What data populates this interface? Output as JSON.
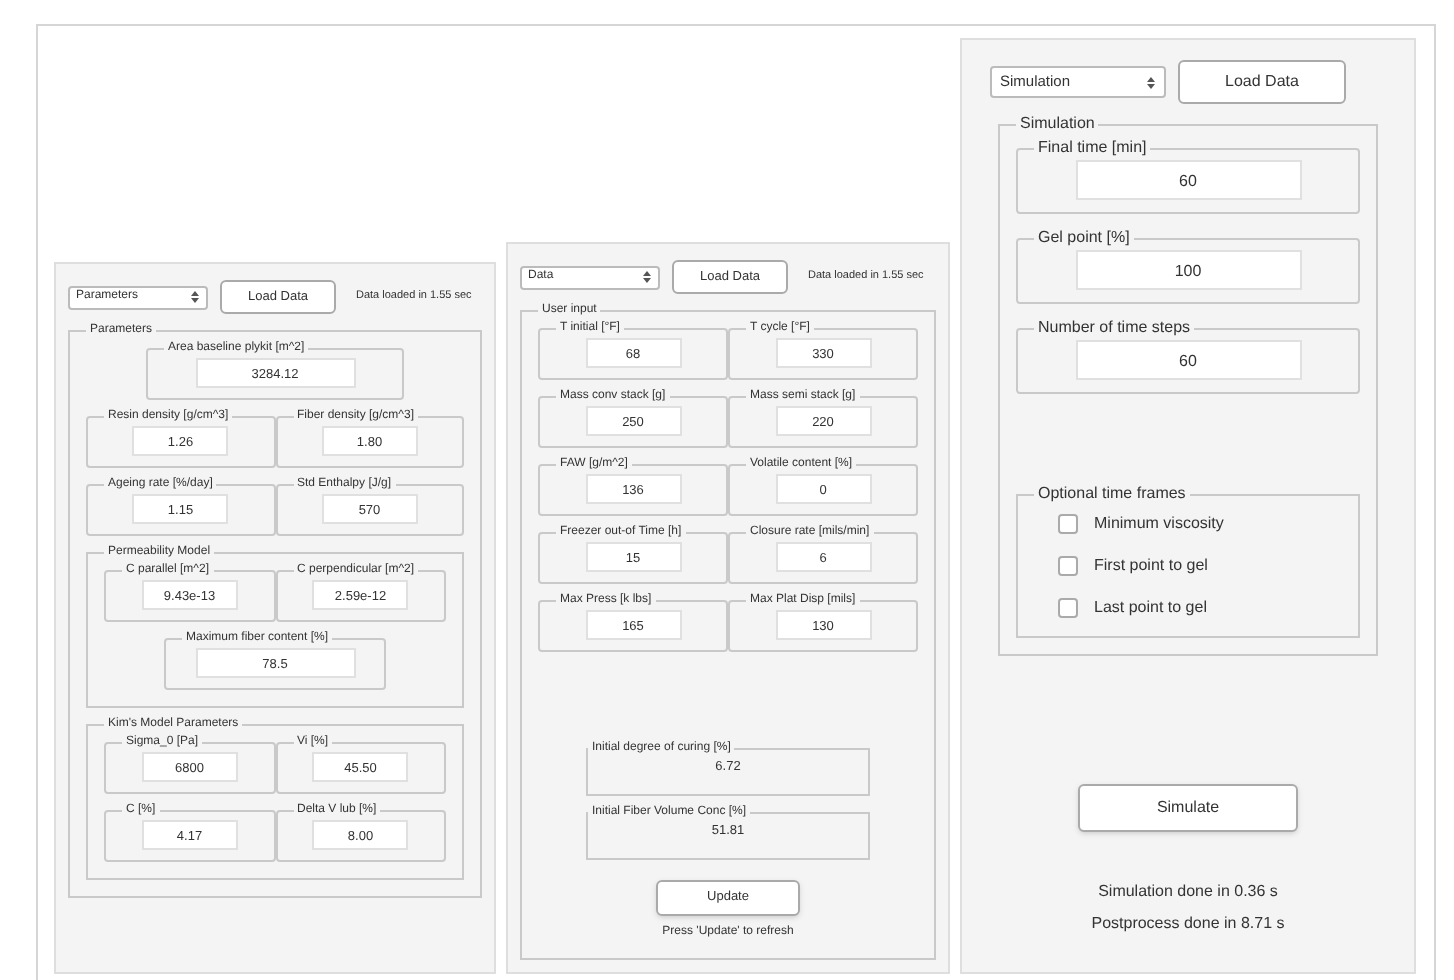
{
  "panels": [
    {
      "dropdown": "Parameters",
      "load_button": "Load Data",
      "status": "Data loaded in 1.55 sec",
      "items": [
        {
          "kind": "group",
          "title": "Parameters",
          "children": [
            {
              "kind": "field",
              "label": "Area baseline plykit [m^2]",
              "value": "3284.12"
            },
            {
              "kind": "pair",
              "fields": [
                {
                  "label": "Resin density [g/cm^3]",
                  "value": "1.26"
                },
                {
                  "label": "Fiber density [g/cm^3]",
                  "value": "1.80"
                }
              ]
            },
            {
              "kind": "pair",
              "fields": [
                {
                  "label": "Ageing rate [%/day]",
                  "value": "1.15"
                },
                {
                  "label": "Std Enthalpy [J/g]",
                  "value": "570"
                }
              ]
            },
            {
              "kind": "group",
              "title": "Permeability Model",
              "children": [
                {
                  "kind": "pair",
                  "fields": [
                    {
                      "label": "C parallel [m^2]",
                      "value": "9.43e-13"
                    },
                    {
                      "label": "C perpendicular [m^2]",
                      "value": "2.59e-12"
                    }
                  ]
                },
                {
                  "kind": "field",
                  "label": "Maximum fiber content [%]",
                  "value": "78.5"
                }
              ]
            },
            {
              "kind": "group",
              "title": "Kim's Model Parameters",
              "children": [
                {
                  "kind": "pair",
                  "fields": [
                    {
                      "label": "Sigma_0 [Pa]",
                      "value": "6800"
                    },
                    {
                      "label": "Vi [%]",
                      "value": "45.50"
                    }
                  ]
                },
                {
                  "kind": "pair",
                  "fields": [
                    {
                      "label": "C [%]",
                      "value": "4.17"
                    },
                    {
                      "label": "Delta V lub [%]",
                      "value": "8.00"
                    }
                  ]
                }
              ]
            }
          ]
        }
      ]
    },
    {
      "dropdown": "Data",
      "load_button": "Load Data",
      "status": "Data loaded in 1.55 sec",
      "items": [
        {
          "kind": "group",
          "title": "User input",
          "children": [
            {
              "kind": "pair",
              "fields": [
                {
                  "label": "T initial [°F]",
                  "value": "68"
                },
                {
                  "label": "T cycle [°F]",
                  "value": "330"
                }
              ]
            },
            {
              "kind": "pair",
              "fields": [
                {
                  "label": "Mass conv stack [g]",
                  "value": "250"
                },
                {
                  "label": "Mass semi stack [g]",
                  "value": "220"
                }
              ]
            },
            {
              "kind": "pair",
              "fields": [
                {
                  "label": "FAW [g/m^2]",
                  "value": "136"
                },
                {
                  "label": "Volatile content [%]",
                  "value": "0"
                }
              ]
            },
            {
              "kind": "pair",
              "fields": [
                {
                  "label": "Freezer out-of Time [h]",
                  "value": "15"
                },
                {
                  "label": "Closure rate [mils/min]",
                  "value": "6"
                }
              ]
            },
            {
              "kind": "pair",
              "fields": [
                {
                  "label": "Max Press [k lbs]",
                  "value": "165"
                },
                {
                  "label": "Max Plat Disp [mils]",
                  "value": "130"
                }
              ]
            },
            {
              "kind": "output",
              "label": "Initial degree of curing [%]",
              "value": "6.72"
            },
            {
              "kind": "output",
              "label": "Initial Fiber Volume Conc [%]",
              "value": "51.81"
            },
            {
              "kind": "button",
              "label": "Update"
            },
            {
              "kind": "note",
              "text": "Press 'Update' to refresh"
            }
          ]
        }
      ]
    },
    {
      "dropdown": "Simulation",
      "load_button": "Load Data",
      "items": [
        {
          "kind": "group",
          "title": "Simulation",
          "children": [
            {
              "kind": "field",
              "label": "Final time [min]",
              "value": "60"
            },
            {
              "kind": "field",
              "label": "Gel point [%]",
              "value": "100"
            },
            {
              "kind": "field",
              "label": "Number of time steps",
              "value": "60"
            },
            {
              "kind": "group",
              "title": "Optional time frames",
              "children": [
                {
                  "kind": "checkbox",
                  "label": "Minimum viscosity",
                  "checked": false
                },
                {
                  "kind": "checkbox",
                  "label": "First point to gel",
                  "checked": false
                },
                {
                  "kind": "checkbox",
                  "label": "Last point to gel",
                  "checked": false
                }
              ]
            }
          ]
        },
        {
          "kind": "button",
          "label": "Simulate"
        },
        {
          "kind": "note",
          "text": "Simulation done in 0.36 s"
        },
        {
          "kind": "note",
          "text": "Postprocess done in 8.71 s"
        }
      ]
    }
  ]
}
